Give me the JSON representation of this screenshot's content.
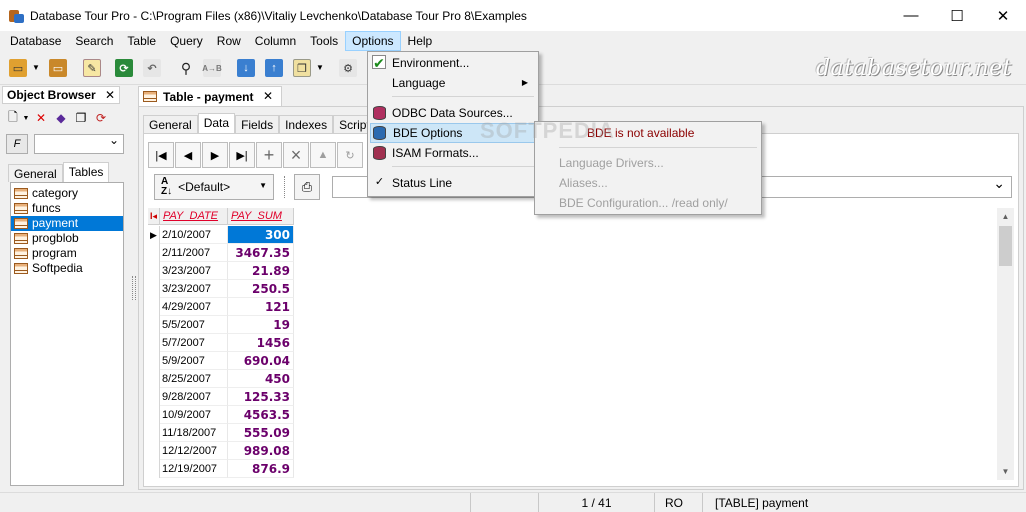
{
  "window": {
    "title": "Database Tour Pro - C:\\Program Files (x86)\\Vitaliy Levchenko\\Database Tour Pro 8\\Examples",
    "minimize": "—",
    "maximize": "☐",
    "close": "✕"
  },
  "menubar": {
    "items": [
      {
        "label": "Database"
      },
      {
        "label": "Search"
      },
      {
        "label": "Table"
      },
      {
        "label": "Query"
      },
      {
        "label": "Row"
      },
      {
        "label": "Column"
      },
      {
        "label": "Tools"
      },
      {
        "label": "Options"
      },
      {
        "label": "Help"
      }
    ]
  },
  "toolbar": {
    "watermark": "databasetour.net"
  },
  "object_browser": {
    "title": "Object Browser",
    "close": "✕",
    "filter_button": "F",
    "tabs": [
      "General",
      "Tables"
    ],
    "items": [
      "category",
      "funcs",
      "payment",
      "progblob",
      "program",
      "Softpedia"
    ],
    "selected_item": "payment"
  },
  "document": {
    "tab_title": "Table - payment",
    "close": "✕",
    "tabs": [
      "General",
      "Data",
      "Fields",
      "Indexes",
      "Script"
    ],
    "active_tab": "Data",
    "sort_combo": "<Default>",
    "grid": {
      "columns": [
        "PAY_DATE",
        "PAY_SUM"
      ],
      "rows": [
        {
          "date": "2/10/2007",
          "sum": "300"
        },
        {
          "date": "2/11/2007",
          "sum": "3467.35"
        },
        {
          "date": "3/23/2007",
          "sum": "21.89"
        },
        {
          "date": "3/23/2007",
          "sum": "250.5"
        },
        {
          "date": "4/29/2007",
          "sum": "121"
        },
        {
          "date": "5/5/2007",
          "sum": "19"
        },
        {
          "date": "5/7/2007",
          "sum": "1456"
        },
        {
          "date": "5/9/2007",
          "sum": "690.04"
        },
        {
          "date": "8/25/2007",
          "sum": "450"
        },
        {
          "date": "9/28/2007",
          "sum": "125.33"
        },
        {
          "date": "10/9/2007",
          "sum": "4563.5"
        },
        {
          "date": "11/18/2007",
          "sum": "555.09"
        },
        {
          "date": "12/12/2007",
          "sum": "989.08"
        },
        {
          "date": "12/19/2007",
          "sum": "876.9"
        }
      ]
    }
  },
  "options_menu": {
    "environment": "Environment...",
    "language": "Language",
    "odbc": "ODBC Data Sources...",
    "bde": "BDE Options",
    "isam": "ISAM Formats...",
    "status_line": "Status Line",
    "status_line_checked": "✓"
  },
  "bde_submenu": {
    "not_available": "BDE is not available",
    "language_drivers": "Language Drivers...",
    "aliases": "Aliases...",
    "configuration": "BDE Configuration... /read only/"
  },
  "statusbar": {
    "position": "1 / 41",
    "mode": "RO",
    "object": "[TABLE] payment"
  },
  "overlay_watermark": "SOFTPEDIA",
  "colors": {
    "selection": "#0078d7",
    "menu_highlight": "#cce8ff",
    "header_text": "#e0002a",
    "sum_text": "#6b006b",
    "warning_text": "#8b0000"
  }
}
